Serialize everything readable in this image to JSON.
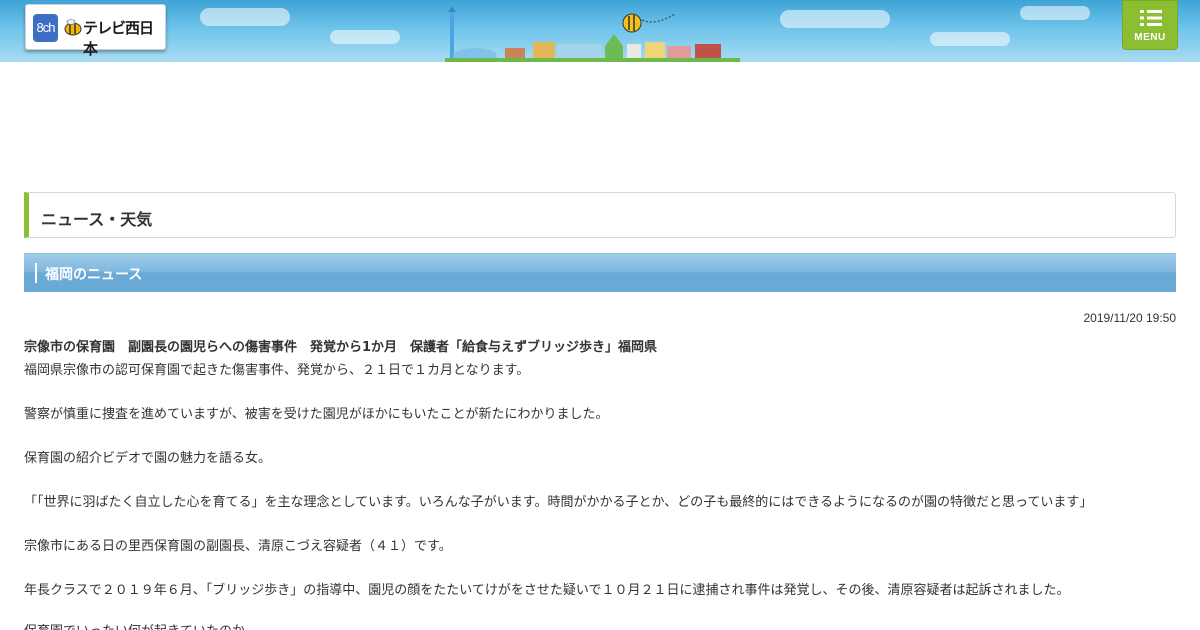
{
  "header": {
    "logo": {
      "channel": "8ch",
      "name": "テレビ西日本"
    },
    "menu_label": "MENU",
    "colors": {
      "sky": "#5bb8e4",
      "menu": "#8cbe32",
      "logo_channel": "#3c6fc4"
    }
  },
  "section": {
    "title": "ニュース・天気",
    "accent_color": "#8cbe32"
  },
  "subsection": {
    "title": "福岡のニュース",
    "bar_color": "#6aa9d5"
  },
  "article": {
    "date": "2019/11/20 19:50",
    "title": "宗像市の保育園　副園長の園児らへの傷害事件　発覚から1か月　保護者「給食与えずブリッジ歩き」福岡県",
    "paragraphs": [
      "福岡県宗像市の認可保育園で起きた傷害事件、発覚から、２１日で１カ月となります。",
      "警察が慎重に捜査を進めていますが、被害を受けた園児がほかにもいたことが新たにわかりました。",
      "保育園の紹介ビデオで園の魅力を語る女。",
      "「「世界に羽ばたく自立した心を育てる」を主な理念としています。いろんな子がいます。時間がかかる子とか、どの子も最終的にはできるようになるのが園の特徴だと思っています」",
      "宗像市にある日の里西保育園の副園長、清原こづえ容疑者（４１）です。",
      "年長クラスで２０１９年６月、「ブリッジ歩き」の指導中、園児の顔をたたいてけがをさせた疑いで１０月２１日に逮捕され事件は発覚し、その後、清原容疑者は起訴されました。",
      "保育園でいったい何が起きていたのか。"
    ]
  }
}
